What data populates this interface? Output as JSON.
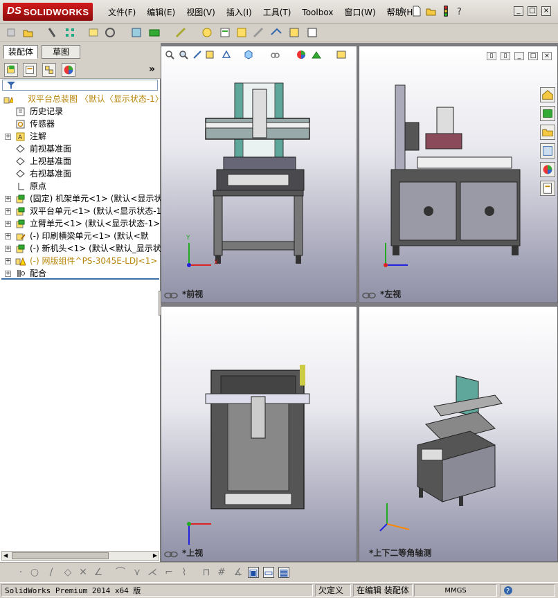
{
  "app": {
    "logo_ds": "DS",
    "logo_text": "SOLIDWORKS"
  },
  "menu": [
    {
      "label": "文件(F)"
    },
    {
      "label": "编辑(E)"
    },
    {
      "label": "视图(V)"
    },
    {
      "label": "插入(I)"
    },
    {
      "label": "工具(T)"
    },
    {
      "label": "Toolbox"
    },
    {
      "label": "窗口(W)"
    },
    {
      "label": "帮助(H)"
    }
  ],
  "feature_manager": {
    "tabs": [
      {
        "label": "装配体"
      },
      {
        "label": "草图"
      }
    ],
    "more": "»",
    "tree": [
      {
        "label": "双平台总装图  〈默认〈显示状态-1〉",
        "level": 0,
        "icon": "assembly-warning-icon",
        "expander": "",
        "warn": true
      },
      {
        "label": "历史记录",
        "level": 1,
        "icon": "history-icon",
        "expander": ""
      },
      {
        "label": "传感器",
        "level": 1,
        "icon": "sensor-icon",
        "expander": ""
      },
      {
        "label": "注解",
        "level": 1,
        "icon": "annotation-icon",
        "expander": "+"
      },
      {
        "label": "前视基准面",
        "level": 1,
        "icon": "plane-icon",
        "expander": ""
      },
      {
        "label": "上视基准面",
        "level": 1,
        "icon": "plane-icon",
        "expander": ""
      },
      {
        "label": "右视基准面",
        "level": 1,
        "icon": "plane-icon",
        "expander": ""
      },
      {
        "label": "原点",
        "level": 1,
        "icon": "origin-icon",
        "expander": ""
      },
      {
        "label": "(固定) 机架单元<1> (默认<显示状",
        "level": 1,
        "icon": "subassembly-icon",
        "expander": "+"
      },
      {
        "label": "双平台单元<1> (默认<显示状态-1>",
        "level": 1,
        "icon": "subassembly-icon",
        "expander": "+"
      },
      {
        "label": "立臂单元<1> (默认<显示状态-1>)",
        "level": 1,
        "icon": "subassembly-icon",
        "expander": "+"
      },
      {
        "label": "(-) 印刷横梁单元<1> (默认<默",
        "level": 1,
        "icon": "subassembly-edit-icon",
        "expander": "+"
      },
      {
        "label": "(-) 新机头<1> (默认<默认_显示状",
        "level": 1,
        "icon": "subassembly-icon",
        "expander": "+"
      },
      {
        "label": "(-) 网版组件^PS-3045E-LDJ<1>",
        "level": 1,
        "icon": "warning-icon",
        "expander": "+",
        "warn": true
      },
      {
        "label": "配合",
        "level": 1,
        "icon": "mates-icon",
        "expander": "+"
      }
    ]
  },
  "viewports": {
    "front": "*前视",
    "left": "*左视",
    "top": "*上视",
    "iso": "*上下二等角轴测"
  },
  "triad": {
    "x": "X",
    "y": "Y",
    "z": "Z"
  },
  "status": {
    "product": "SolidWorks Premium 2014 x64 版",
    "definition": "欠定义",
    "editing": "在编辑 装配体",
    "units": "MMGS",
    "help_icon": "question-icon"
  },
  "colors": {
    "brand_red": "#b01414",
    "machine_gray": "#4a4a4e",
    "panel_teal": "#5ea79a",
    "selection_blue": "#3a6ea5"
  }
}
